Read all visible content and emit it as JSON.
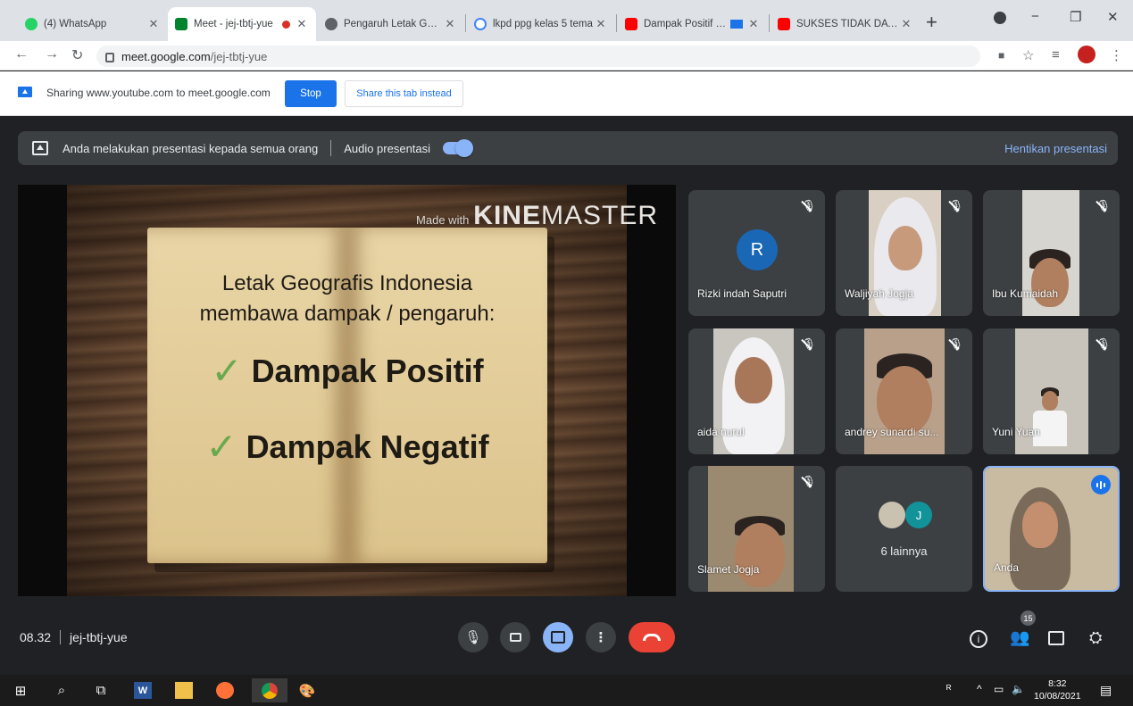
{
  "browser": {
    "tabs": [
      {
        "label": "(4) WhatsApp",
        "active": false,
        "icon": "whatsapp-icon",
        "color": "#25d366"
      },
      {
        "label": "Meet - jej-tbtj-yue",
        "active": true,
        "icon": "meet-icon",
        "color": "#00832d"
      },
      {
        "label": "Pengaruh Letak Geogr",
        "active": false,
        "icon": "globe-icon",
        "color": "#5f6368"
      },
      {
        "label": "lkpd ppg kelas 5 tema",
        "active": false,
        "icon": "google-icon",
        "color": "#4285f4"
      },
      {
        "label": "Dampak Positif Da",
        "active": false,
        "icon": "youtube-icon",
        "color": "#ff0000"
      },
      {
        "label": "SUKSES TIDAK DATANG",
        "active": false,
        "icon": "youtube-icon",
        "color": "#ff0000"
      }
    ],
    "url_domain": "meet.google.com",
    "url_path": "/jej-tbtj-yue"
  },
  "sharebar": {
    "message": "Sharing www.youtube.com to meet.google.com",
    "stop_label": "Stop",
    "share_tab_label": "Share this tab instead"
  },
  "meet": {
    "presenting_text": "Anda melakukan presentasi kepada semua orang",
    "audio_label": "Audio presentasi",
    "audio_on": true,
    "stop_presenting_label": "Hentikan presentasi",
    "slide": {
      "watermark_made": "Made with",
      "watermark_brand_bold": "KINE",
      "watermark_brand": "MASTER",
      "line1": "Letak Geografis Indonesia",
      "line2": "membawa dampak / pengaruh:",
      "bullet1": "Dampak Positif",
      "bullet2": "Dampak Negatif"
    },
    "participants": [
      {
        "name": "Rizki indah Saputri",
        "initial": "R",
        "muted": true
      },
      {
        "name": "Waljiyah Jogja",
        "muted": true
      },
      {
        "name": "Ibu Kumaidah",
        "muted": true
      },
      {
        "name": "aida nurul",
        "muted": true
      },
      {
        "name": "andrey sunardi su...",
        "muted": true
      },
      {
        "name": "Yuni Yuan",
        "muted": true
      },
      {
        "name": "Slamet Jogja",
        "muted": true
      },
      {
        "name": "6 lainnya",
        "initial": "J"
      },
      {
        "name": "Anda",
        "speaking": true
      }
    ],
    "time": "08.32",
    "meeting_code": "jej-tbtj-yue",
    "people_count": "15"
  },
  "taskbar": {
    "time": "8:32",
    "date": "10/08/2021"
  }
}
